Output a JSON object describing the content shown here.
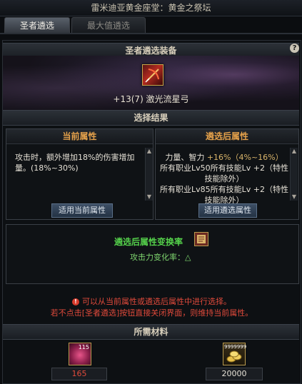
{
  "window": {
    "title": "雷米迪亚黄金座堂：黄金之祭坛"
  },
  "tabs": [
    {
      "label": "圣者遴选",
      "active": true
    },
    {
      "label": "最大值遴选",
      "active": false
    }
  ],
  "equipment_section": {
    "header": "圣者遴选装备",
    "help_label": "?",
    "item_name": "+13(7) 激光流星弓"
  },
  "result_section": {
    "header": "选择结果",
    "current": {
      "title": "当前属性",
      "text_prefix": "攻击时，",
      "text_body": "额外增加18%的伤害增加量。(18%~30%)",
      "button": "适用当前属性"
    },
    "after": {
      "title": "遴选后属性",
      "lines": [
        {
          "label": "力量、智力 ",
          "value": "+16%（4%~16%）"
        },
        {
          "label": "所有职业Lv50所有技能Lv ",
          "value": "+2（特性技能除外）"
        },
        {
          "label": "所有职业Lv85所有技能Lv ",
          "value": "+2（特性技能除外）"
        }
      ],
      "button": "适用遴选属性"
    }
  },
  "conversion": {
    "title": "遴选后属性变换率",
    "rate_label": "攻击力变化率：",
    "rate_symbol": "△"
  },
  "notice": {
    "line1": "可以从当前属性或遴选后属性中进行选择。",
    "line2": "若不点击[圣者遴选]按钮直接关闭界面，则维持当前属性。",
    "icon": "!"
  },
  "materials": {
    "header": "所需材料",
    "items": [
      {
        "icon": "crystal-icon",
        "badge": "115",
        "count": "165"
      },
      {
        "icon": "gold-coins-icon",
        "badge": "9999999",
        "count": "20000"
      }
    ]
  },
  "colors": {
    "orange_title": "#e6a24b",
    "green": "#55d24b",
    "red": "#e04a3b"
  }
}
